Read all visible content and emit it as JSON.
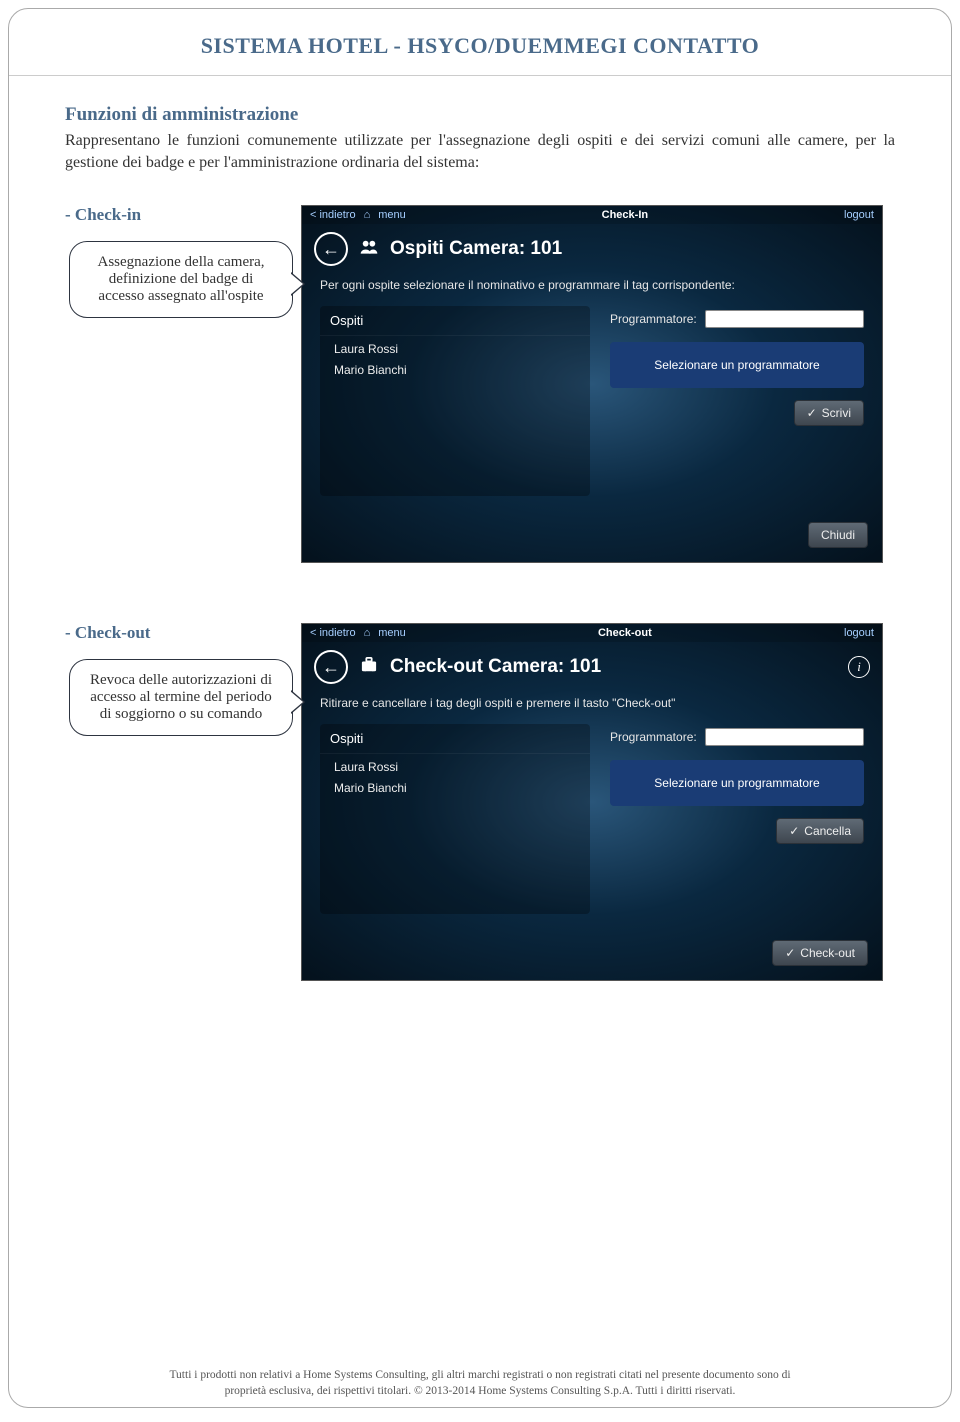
{
  "doc": {
    "title": "SISTEMA HOTEL - HSYCO/DUEMMEGI CONTATTO",
    "section_heading": "Funzioni di amministrazione",
    "section_body": "Rappresentano le funzioni comunemente utilizzate per l'assegnazione degli ospiti e dei servizi comuni alle camere, per la gestione dei badge e per l'amministrazione ordinaria del sistema:",
    "footer_line1": "Tutti i prodotti non relativi a Home Systems Consulting, gli altri marchi registrati o non registrati citati nel presente documento sono di",
    "footer_line2": "proprietà esclusiva, dei rispettivi titolari.   © 2013-2014 Home Systems Consulting S.p.A. Tutti i diritti riservati."
  },
  "checkin": {
    "subtitle": "- Check-in",
    "callout": "Assegnazione della camera, definizione del badge di accesso assegnato all'ospite",
    "topbar": {
      "back": "< indietro",
      "menu": "menu",
      "title": "Check-In",
      "logout": "logout"
    },
    "header_title": "Ospiti Camera: 101",
    "subtext": "Per ogni ospite selezionare il nominativo e programmare il tag corrispondente:",
    "ospiti_label": "Ospiti",
    "ospiti": [
      "Laura Rossi",
      "Mario Bianchi"
    ],
    "prog_label": "Programmatore:",
    "prog_panel_text": "Selezionare un programmatore",
    "btn_scrivi": "Scrivi",
    "btn_chiudi": "Chiudi"
  },
  "checkout": {
    "subtitle": "- Check-out",
    "callout": "Revoca delle autorizzazioni di accesso al termine del periodo di soggiorno o su comando",
    "topbar": {
      "back": "< indietro",
      "menu": "menu",
      "title": "Check-out",
      "logout": "logout"
    },
    "header_title": "Check-out Camera: 101",
    "subtext": "Ritirare e cancellare i tag degli ospiti e premere il tasto \"Check-out\"",
    "ospiti_label": "Ospiti",
    "ospiti": [
      "Laura Rossi",
      "Mario Bianchi"
    ],
    "prog_label": "Programmatore:",
    "prog_panel_text": "Selezionare un programmatore",
    "btn_cancella": "Cancella",
    "btn_checkout": "Check-out"
  }
}
